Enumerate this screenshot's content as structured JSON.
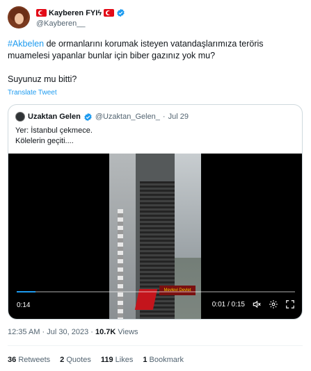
{
  "tweet": {
    "author_name": "Kayberen FYIϟ",
    "author_handle": "@Kayberen__",
    "hashtag": "#Akbelen",
    "text_rest": " de ormanlarını korumak isteyen vatandaşlarımıza teröris muamelesi yapanlar bunlar için biber gazınız yok mu?",
    "text_line2": "Suyunuz mu bitti?",
    "translate_label": "Translate Tweet",
    "timestamp": "12:35 AM · Jul 30, 2023 · ",
    "views_count": "10.7K",
    "views_label": " Views"
  },
  "quote": {
    "name": "Uzaktan Gelen",
    "handle": "@Uzaktan_Gelen_",
    "dot": "·",
    "date": "Jul 29",
    "line1": "Yer: İstanbul çekmece.",
    "line2": "Kölelerin geçiti....",
    "banner_text": "Mevlevi Devlet",
    "video": {
      "remaining": "0:14",
      "position": "0:01 / 0:15",
      "progress": 0.067
    }
  },
  "stats": {
    "retweets_count": "36",
    "retweets_label": "Retweets",
    "quotes_count": "2",
    "quotes_label": "Quotes",
    "likes_count": "119",
    "likes_label": "Likes",
    "bookmarks_count": "1",
    "bookmarks_label": "Bookmark"
  },
  "colors": {
    "accent": "#1d9bf0",
    "text_primary": "#0f1419",
    "text_secondary": "#536471",
    "flag_red": "#e30a17"
  },
  "icons": [
    "turkey-flag-icon",
    "verified-badge-icon",
    "volume-muted-icon",
    "settings-gear-icon",
    "fullscreen-icon"
  ]
}
